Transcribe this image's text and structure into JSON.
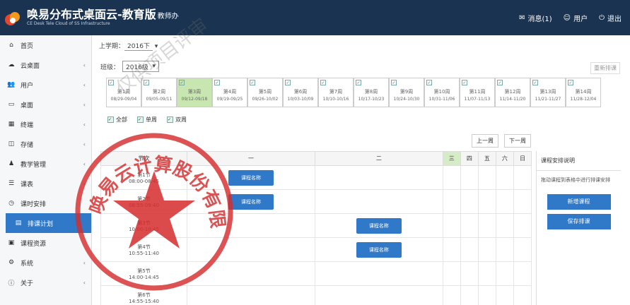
{
  "header": {
    "title": "唤易分布式桌面云-教育版",
    "title_suffix": "教师办",
    "subtitle": "CE Desk Tele Cloud of SS Infrastructure",
    "right": [
      {
        "icon": "message-icon",
        "label": "消息(1)"
      },
      {
        "icon": "user-icon",
        "label": "用户"
      },
      {
        "icon": "logout-icon",
        "label": "退出"
      }
    ]
  },
  "sidebar": {
    "items": [
      {
        "icon": "home-icon",
        "label": "首页",
        "chevron": ""
      },
      {
        "icon": "cloud-icon",
        "label": "云桌面",
        "chevron": "‹"
      },
      {
        "icon": "users-icon",
        "label": "用户",
        "chevron": "‹"
      },
      {
        "icon": "monitor-icon",
        "label": "桌面",
        "chevron": "‹"
      },
      {
        "icon": "table-icon",
        "label": "终端",
        "chevron": "‹"
      },
      {
        "icon": "storage-icon",
        "label": "存储",
        "chevron": "‹"
      },
      {
        "icon": "teacher-icon",
        "label": "教学管理",
        "chevron": "‹"
      },
      {
        "icon": "list-icon",
        "label": "课表",
        "chevron": "‹"
      },
      {
        "icon": "clock-icon",
        "label": "课时安排",
        "chevron": ""
      },
      {
        "icon": "calendar-icon",
        "label": "排课计划",
        "chevron": "",
        "active": true
      },
      {
        "icon": "doc-icon",
        "label": "课程资源",
        "chevron": ""
      },
      {
        "icon": "gear-icon",
        "label": "系统",
        "chevron": "‹"
      },
      {
        "icon": "info-icon",
        "label": "关于",
        "chevron": "‹"
      }
    ]
  },
  "filters": {
    "term_label": "上学期：",
    "term_value": "2016下",
    "class_label": "班级：",
    "class_value": "2016级"
  },
  "reset_label": "重新排课",
  "weeks": [
    {
      "name": "第1周",
      "dates": "08/29-09/04",
      "selected": false
    },
    {
      "name": "第2周",
      "dates": "09/05-09/11",
      "selected": false
    },
    {
      "name": "第3周",
      "dates": "09/12-09/18",
      "selected": true
    },
    {
      "name": "第4周",
      "dates": "09/19-09/25",
      "selected": false
    },
    {
      "name": "第5周",
      "dates": "09/26-10/02",
      "selected": false
    },
    {
      "name": "第6周",
      "dates": "10/03-10/09",
      "selected": false
    },
    {
      "name": "第7周",
      "dates": "10/10-10/16",
      "selected": false
    },
    {
      "name": "第8周",
      "dates": "10/17-10/23",
      "selected": false
    },
    {
      "name": "第9周",
      "dates": "10/24-10/30",
      "selected": false
    },
    {
      "name": "第10周",
      "dates": "10/31-11/06",
      "selected": false
    },
    {
      "name": "第11周",
      "dates": "11/07-11/13",
      "selected": false
    },
    {
      "name": "第12周",
      "dates": "11/14-11/20",
      "selected": false
    },
    {
      "name": "第13周",
      "dates": "11/21-11/27",
      "selected": false
    },
    {
      "name": "第14周",
      "dates": "11/28-12/04",
      "selected": false
    }
  ],
  "legend": [
    "全部",
    "单周",
    "双周"
  ],
  "toolbar": {
    "prev_label": "上一周",
    "next_label": "下一周"
  },
  "grid": {
    "headers": [
      "节次",
      "一",
      "二",
      "三",
      "四",
      "五",
      "六",
      "日"
    ],
    "today_index": 3,
    "rows": [
      {
        "period": "第1节",
        "time": "08:00-08:45"
      },
      {
        "period": "第2节",
        "time": "08:55-09:40"
      },
      {
        "period": "第3节",
        "time": "10:00-10:45"
      },
      {
        "period": "第4节",
        "time": "10:55-11:40"
      },
      {
        "period": "第5节",
        "time": "14:00-14:45"
      },
      {
        "period": "第6节",
        "time": "14:55-15:40"
      }
    ],
    "blocks": [
      {
        "row": 0,
        "col": 1,
        "label": "课程名称"
      },
      {
        "row": 1,
        "col": 1,
        "label": "课程名称"
      },
      {
        "row": 2,
        "col": 2,
        "label": "课程名称"
      },
      {
        "row": 3,
        "col": 2,
        "label": "课程名称"
      }
    ]
  },
  "right_panel": {
    "title": "课程安排说明",
    "text": "拖动课程到表格中进行排课安排",
    "btn1": "新增课程",
    "btn2": "保存排课"
  },
  "watermark": "仅供项目评审",
  "seal_text": "唤易云计算股份有限公司"
}
